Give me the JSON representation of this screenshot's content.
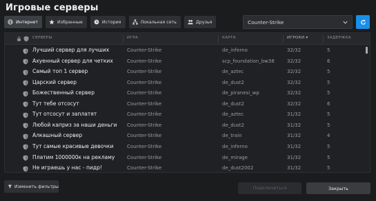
{
  "window": {
    "title": "Игровые серверы"
  },
  "tabs": [
    {
      "label": "Интернет",
      "icon": "globe-icon",
      "active": true
    },
    {
      "label": "Избранные",
      "icon": "star-icon",
      "active": false
    },
    {
      "label": "История",
      "icon": "clock-icon",
      "active": false
    },
    {
      "label": "Локальная сеть",
      "icon": "network-icon",
      "active": false
    },
    {
      "label": "Друзья",
      "icon": "friends-icon",
      "active": false
    }
  ],
  "game_filter": {
    "selected": "Counter-Strike"
  },
  "columns": {
    "servers": "СЕРВЕРЫ",
    "game": "ИГРА",
    "map": "КАРТА",
    "players": "ИГРОКИ ▾",
    "ping": "ЗАДЕРЖКА"
  },
  "servers": [
    {
      "name": "Лучший сервер для лучших",
      "game": "Counter-Strike",
      "map": "de_inferno",
      "players": "32/32",
      "ping": "5"
    },
    {
      "name": "Ахуенный сервер для четких",
      "game": "Counter-Strike",
      "map": "scp_foundation_bw38",
      "players": "32/32",
      "ping": "6"
    },
    {
      "name": "Самый топ 1 сервер",
      "game": "Counter-Strike",
      "map": "de_aztec",
      "players": "32/32",
      "ping": "5"
    },
    {
      "name": "Царский сервер",
      "game": "Counter-Strike",
      "map": "de_dust2",
      "players": "32/32",
      "ping": "5"
    },
    {
      "name": "Божественный сервер",
      "game": "Counter-Strike",
      "map": "de_piranesi_wp",
      "players": "32/32",
      "ping": "5"
    },
    {
      "name": "Тут тебе отсосут",
      "game": "Counter-Strike",
      "map": "de_dust2",
      "players": "32/32",
      "ping": "6"
    },
    {
      "name": "Тут отсосут и заплатят",
      "game": "Counter-Strike",
      "map": "de_aztec",
      "players": "31/32",
      "ping": "5"
    },
    {
      "name": "Любой каприз за наши деньги",
      "game": "Counter-Strike",
      "map": "de_dust2",
      "players": "31/32",
      "ping": "5"
    },
    {
      "name": "Алкашный сервер",
      "game": "Counter-Strike",
      "map": "de_train",
      "players": "31/32",
      "ping": "4"
    },
    {
      "name": "Тут самые красивые девочки",
      "game": "Counter-Strike",
      "map": "de_inferno",
      "players": "31/32",
      "ping": "5"
    },
    {
      "name": "Платим 1000000к на рекламу",
      "game": "Counter-Strike",
      "map": "de_mirage",
      "players": "31/32",
      "ping": "5"
    },
    {
      "name": "Не играешь у нас - пидр!",
      "game": "Counter-Strike",
      "map": "de_dust2002",
      "players": "31/32",
      "ping": "5"
    }
  ],
  "footer": {
    "change_filters": "Изменить фильтры",
    "connect": "Подключиться",
    "close": "Закрыть"
  },
  "colors": {
    "accent": "#1a8fe8",
    "background": "#1b1c1e"
  }
}
